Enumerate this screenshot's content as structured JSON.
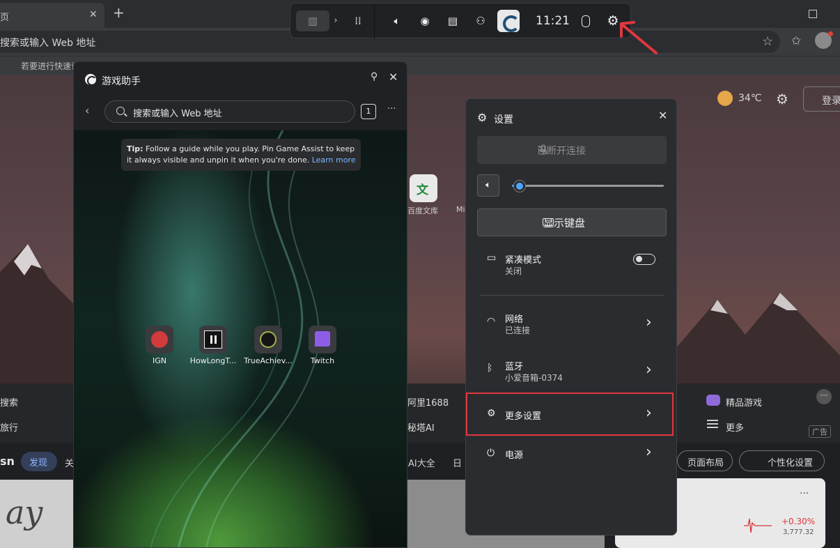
{
  "browser": {
    "tab_title": "页",
    "tab_close": "✕",
    "new_tab": "+",
    "address_text": "搜索或输入 Web 地址",
    "bookmark_text": "若要进行快速访问",
    "icons": [
      "star-icon",
      "favorites-icon",
      "avatar"
    ]
  },
  "page": {
    "weather_temp": "34℃",
    "login": "登录",
    "quick_link_1": "百度文库",
    "quick_link_2": "Mi",
    "nav": {
      "search": "搜索",
      "travel": "旅行",
      "alibaba": "阿里1688",
      "mita": "秘塔AI",
      "games": "精品游戏",
      "more": "更多",
      "ad": "广告",
      "dots": "···"
    },
    "msn": "sn",
    "discover": "发现",
    "guan": "关",
    "ai_all": "AI大全",
    "ri": "日",
    "layout_btn": "页面布局",
    "personalize_btn": "个性化设置",
    "card_dots": "···",
    "stock_change": "+0.30%",
    "stock_value": "3,777.32",
    "card_word": "ay"
  },
  "gamebar": {
    "time": "11:21",
    "icons": [
      "home-icon",
      "chevron-right-icon",
      "widget-menu-icon",
      "volume-icon",
      "capture-icon",
      "performance-icon",
      "social-icon",
      "edge-icon",
      "mouse-icon",
      "settings-gear-icon"
    ]
  },
  "assist": {
    "title": "游戏助手",
    "search_placeholder": "搜索或输入 Web 地址",
    "tab_count": "1",
    "more": "···",
    "tip_bold": "Tip:",
    "tip_text": " Follow a guide while you play. Pin Game Assist to keep it always visible and unpin it when you're done. ",
    "tip_link": "Learn more",
    "sites": [
      {
        "label": "IGN"
      },
      {
        "label": "HowLongT..."
      },
      {
        "label": "TrueAchiev..."
      },
      {
        "label": "Twitch"
      }
    ]
  },
  "settings": {
    "title": "设置",
    "disconnected": "已断开连接",
    "volume_level": 0.05,
    "keyboard": "显示键盘",
    "compact_title": "紧凑模式",
    "compact_sub": "关闭",
    "network_title": "网络",
    "network_sub": "已连接",
    "bt_title": "蓝牙",
    "bt_sub": "小爱音箱-0374",
    "more_title": "更多设置",
    "power_title": "电源",
    "highlight_color": "#e0383e"
  }
}
